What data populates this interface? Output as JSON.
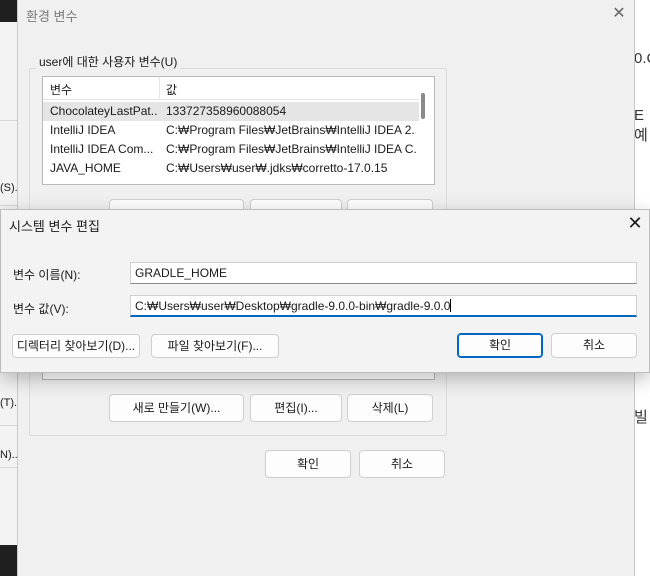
{
  "background": {
    "left_labels": [
      "(S).",
      "(T).",
      "N)..."
    ],
    "right_labels": [
      "0.C",
      "E예",
      "빌"
    ]
  },
  "env_dialog": {
    "title": "환경 변수",
    "close_glyph": "✕",
    "user_group_label": "user에 대한 사용자 변수(U)",
    "columns": [
      "변수",
      "값"
    ],
    "rows": [
      {
        "name": "ChocolateyLastPat...",
        "value": "133727358960088054",
        "selected": true
      },
      {
        "name": "IntelliJ IDEA",
        "value": "C:₩Program Files₩JetBrains₩IntelliJ IDEA 2...",
        "selected": false
      },
      {
        "name": "IntelliJ IDEA Com...",
        "value": "C:₩Program Files₩JetBrains₩IntelliJ IDEA C...",
        "selected": false
      },
      {
        "name": "JAVA_HOME",
        "value": "C:₩Users₩user₩.jdks₩corretto-17.0.15",
        "selected": false
      }
    ],
    "system_buttons": {
      "new_label": "새로 만들기(W)...",
      "edit_label": "편집(I)...",
      "delete_label": "삭제(L)"
    },
    "ok_label": "확인",
    "cancel_label": "취소"
  },
  "edit_dialog": {
    "title": "시스템 변수 편집",
    "close_glyph": "✕",
    "name_label": "변수 이름(N):",
    "name_value": "GRADLE_HOME",
    "value_label": "변수 값(V):",
    "value_value": "C:₩Users₩user₩Desktop₩gradle-9.0.0-bin₩gradle-9.0.0",
    "browse_dir_label": "디렉터리 찾아보기(D)...",
    "browse_file_label": "파일 찾아보기(F)...",
    "ok_label": "확인",
    "cancel_label": "취소"
  },
  "colors": {
    "accent": "#0067c0",
    "dialog_bg": "#f0f0f0",
    "selected_row": "#e5e5e5"
  }
}
